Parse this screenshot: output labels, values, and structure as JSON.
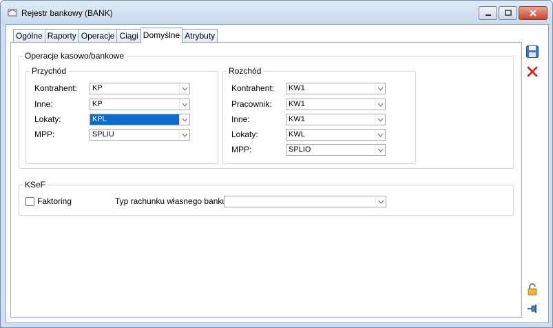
{
  "window": {
    "title": "Rejestr bankowy (BANK)"
  },
  "tabs": [
    {
      "label": "Ogólne"
    },
    {
      "label": "Raporty"
    },
    {
      "label": "Operacje"
    },
    {
      "label": "Ciągi"
    },
    {
      "label": "Domyślne"
    },
    {
      "label": "Atrybuty"
    }
  ],
  "operations": {
    "title": "Operacje kasowo/bankowe",
    "income": {
      "title": "Przychód",
      "rows": [
        {
          "label": "Kontrahent:",
          "value": "KP"
        },
        {
          "label": "Inne:",
          "value": "KP"
        },
        {
          "label": "Lokaty:",
          "value": "KPL"
        },
        {
          "label": "MPP:",
          "value": "SPLIU"
        }
      ]
    },
    "expense": {
      "title": "Rozchód",
      "rows": [
        {
          "label": "Kontrahent:",
          "value": "KW1"
        },
        {
          "label": "Pracownik:",
          "value": "KW1"
        },
        {
          "label": "Inne:",
          "value": "KW1"
        },
        {
          "label": "Lokaty:",
          "value": "KWL"
        },
        {
          "label": "MPP:",
          "value": "SPLIO"
        }
      ]
    }
  },
  "ksef": {
    "title": "KSeF",
    "factoring_label": "Faktoring",
    "factoring_checked": false,
    "account_type_label": "Typ rachunku własnego banku:",
    "account_type_value": ""
  },
  "icons": {
    "save": "save-icon",
    "cancel": "cancel-icon",
    "lock": "lock-icon",
    "pin": "pin-icon"
  }
}
